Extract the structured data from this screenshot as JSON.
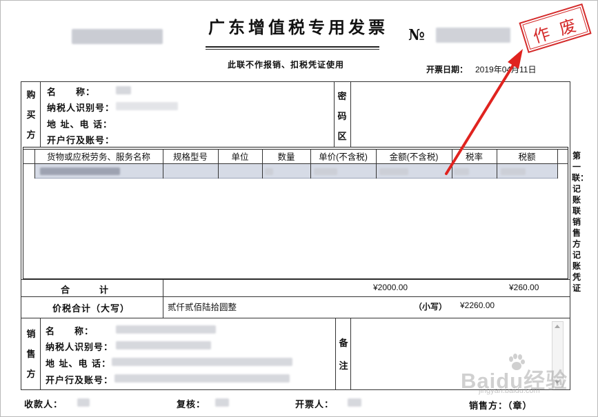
{
  "header": {
    "title": "广东增值税专用发票",
    "no_label": "№",
    "subtitle": "此联不作报销、扣税凭证使用",
    "date_label": "开票日期：",
    "date_value": "2019年04月11日"
  },
  "stamp": {
    "text": "作 废",
    "color": "#d42a2a"
  },
  "buyer": {
    "section_label": [
      "购",
      "买",
      "方"
    ],
    "name_label": "名　　称：",
    "tax_id_label": "纳税人识别号：",
    "address_label": "地 址、电 话：",
    "bank_label": "开户行及账号：",
    "cipher_label": [
      "密",
      "码",
      "区"
    ]
  },
  "items_table": {
    "headers": [
      "货物或应税劳务、服务名称",
      "规格型号",
      "单位",
      "数量",
      "单价(不含税)",
      "金额(不含税)",
      "税率",
      "税额"
    ],
    "selected_row_color": "#d6dbe6"
  },
  "totals": {
    "label": "合　　　计",
    "amount": "¥2000.00",
    "tax": "¥260.00",
    "grand_label": "价税合计（大写）",
    "grand_text": "贰仟贰佰陆拾圆整",
    "grand_small_label": "（小写）",
    "grand_small_value": "¥2260.00"
  },
  "seller": {
    "section_label": [
      "销",
      "售",
      "方"
    ],
    "name_label": "名　　称：",
    "tax_id_label": "纳税人识别号：",
    "address_label": "地 址、电 话：",
    "bank_label": "开户行及账号：",
    "remark_label": [
      "备",
      "注"
    ]
  },
  "side_label": "第一联：记账联　销售方记账凭证",
  "footer": {
    "payee_label": "收款人：",
    "reviewer_label": "复核：",
    "drawer_label": "开票人：",
    "seller_label": "销售方：（章）"
  },
  "watermark": "Baidu经验",
  "watermark_sub": "jingyan.baidu.com",
  "annotation": {
    "arrow_color": "#e0231f"
  }
}
